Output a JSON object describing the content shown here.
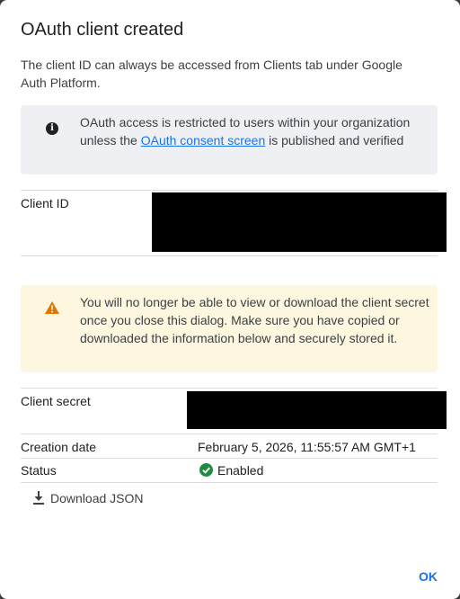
{
  "dialog": {
    "title": "OAuth client created",
    "subtitle": "The client ID can always be accessed from Clients tab under Google Auth Platform."
  },
  "info": {
    "icon": "info-icon",
    "text_before": "OAuth access is restricted to users within your organization unless the ",
    "link": "OAuth consent screen",
    "text_after": " is published and verified"
  },
  "client_id": {
    "label": "Client ID"
  },
  "warning": {
    "icon": "warning-icon",
    "text": "You will no longer be able to view or download the client secret once you close this dialog. Make sure you have copied or downloaded the information below and securely stored it."
  },
  "details": {
    "client_secret_label": "Client secret",
    "creation_date_label": "Creation date",
    "creation_date_value": "February 5, 2026, 11:55:57 AM GMT+1",
    "status_label": "Status",
    "status_value": "Enabled",
    "status_icon": "check-circle-icon"
  },
  "actions": {
    "download_label": "Download JSON",
    "download_icon": "download-icon",
    "ok_label": "OK"
  },
  "colors": {
    "accent": "#1a73e8",
    "success": "#1e8e3e",
    "warning": "#e37400",
    "info_bg": "#eef0f3",
    "warning_bg": "#fef7e0"
  }
}
